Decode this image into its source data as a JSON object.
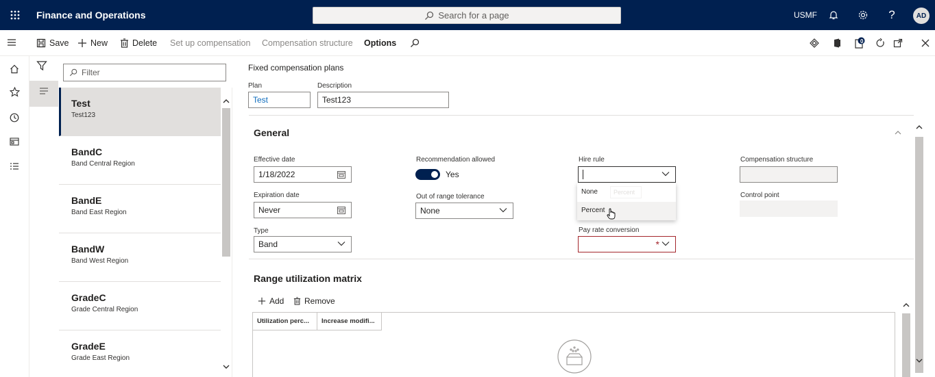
{
  "topbar": {
    "app_title": "Finance and Operations",
    "search_placeholder": "Search for a page",
    "company": "USMF",
    "avatar_initials": "AD",
    "notification_count": "0"
  },
  "actions": {
    "save": "Save",
    "new": "New",
    "delete": "Delete",
    "setup_compensation": "Set up compensation",
    "compensation_structure": "Compensation structure",
    "options": "Options"
  },
  "list": {
    "filter_placeholder": "Filter",
    "items": [
      {
        "title": "Test",
        "subtitle": "Test123"
      },
      {
        "title": "BandC",
        "subtitle": "Band Central Region"
      },
      {
        "title": "BandE",
        "subtitle": "Band East Region"
      },
      {
        "title": "BandW",
        "subtitle": "Band West Region"
      },
      {
        "title": "GradeC",
        "subtitle": "Grade Central Region"
      },
      {
        "title": "GradeE",
        "subtitle": "Grade East Region"
      }
    ]
  },
  "form": {
    "page_label": "Fixed compensation plans",
    "plan_label": "Plan",
    "plan_value": "Test",
    "description_label": "Description",
    "description_value": "Test123",
    "general_title": "General",
    "effective_date_label": "Effective date",
    "effective_date_value": "1/18/2022",
    "expiration_date_label": "Expiration date",
    "expiration_date_value": "Never",
    "type_label": "Type",
    "type_value": "Band",
    "recommendation_label": "Recommendation allowed",
    "recommendation_value": "Yes",
    "out_of_range_label": "Out of range tolerance",
    "out_of_range_value": "None",
    "hire_rule_label": "Hire rule",
    "hire_rule_value": "",
    "hire_rule_options": [
      "None",
      "Percent"
    ],
    "hire_rule_ghost": "Percent",
    "pay_rate_label": "Pay rate conversion",
    "pay_rate_required": "*",
    "comp_structure_label": "Compensation structure",
    "control_point_label": "Control point",
    "range_title": "Range utilization matrix",
    "add": "Add",
    "remove": "Remove",
    "columns": [
      "Utilization perc...",
      "Increase modifi..."
    ]
  },
  "colors": {
    "topbar": "#002050",
    "accent": "#0f6cbd",
    "required": "#a4262c"
  }
}
